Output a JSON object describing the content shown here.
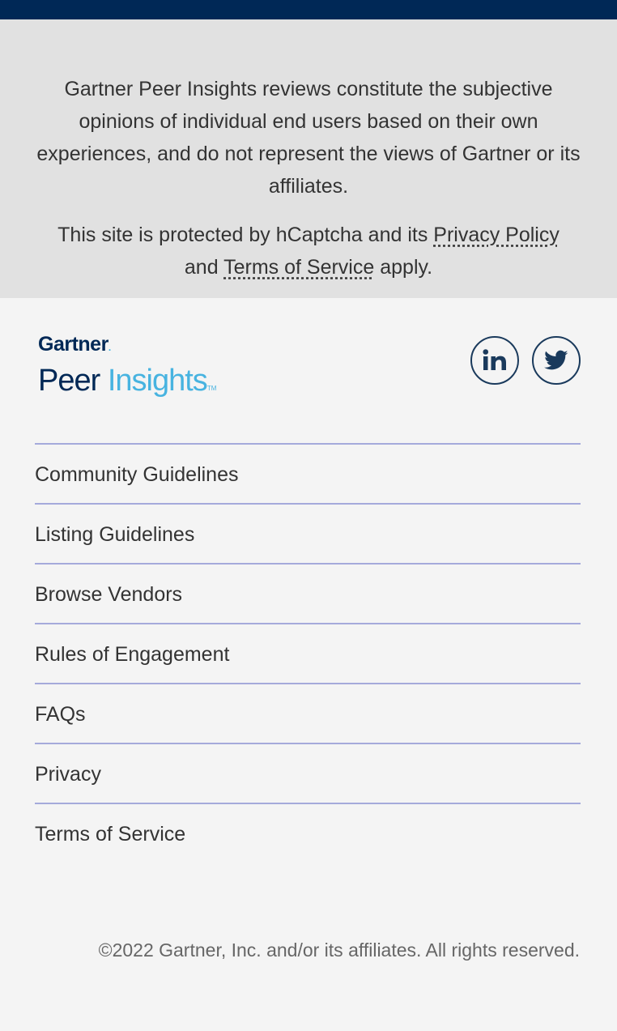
{
  "disclaimer": {
    "review_text": "Gartner Peer Insights reviews constitute the subjective opinions of individual end users based on their own experiences, and do not represent the views of Gartner or its affiliates.",
    "captcha_prefix": "This site is protected by hCaptcha and its ",
    "privacy_link": "Privacy Policy",
    "captcha_middle": " and ",
    "terms_link": "Terms of Service",
    "captcha_suffix": " apply."
  },
  "logo": {
    "brand": "Gartner",
    "brand_dot": ".",
    "product_peer": "Peer",
    "product_insights": "Insights",
    "trademark": "TM"
  },
  "social": {
    "icons": [
      "linkedin-icon",
      "twitter-icon"
    ]
  },
  "footer_links": [
    "Community Guidelines",
    "Listing Guidelines",
    "Browse Vendors",
    "Rules of Engagement",
    "FAQs",
    "Privacy",
    "Terms of Service"
  ],
  "copyright": "©2022 Gartner, Inc. and/or its affiliates. All rights reserved.",
  "colors": {
    "topbar": "#002856",
    "disclaimer_bg": "#e1e1e1",
    "footer_bg": "#f4f4f4",
    "divider": "#a5aadb",
    "insights_blue": "#47b3e0"
  }
}
